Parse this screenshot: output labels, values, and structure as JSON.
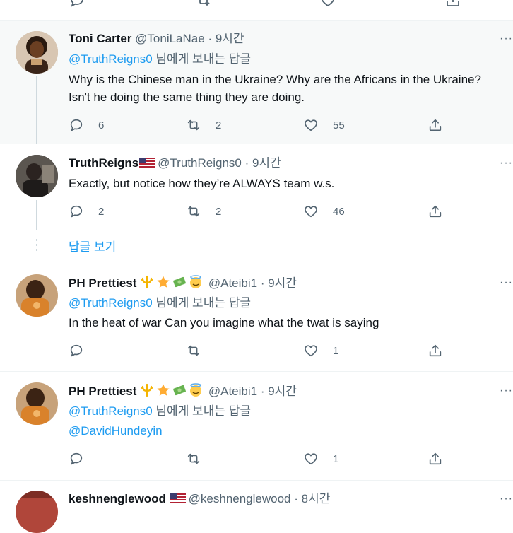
{
  "tweets": [
    {
      "name": "Toni Carter",
      "handle": "@ToniLaNae",
      "time": "9시간",
      "reply_to_handle": "@TruthReigns0",
      "reply_to_suffix": " 님에게 보내는 답글",
      "text": "Why is the Chinese man in the Ukraine? Why are the Africans in the Ukraine? Isn't he doing the same thing they are doing.",
      "replies": "6",
      "retweets": "2",
      "likes": "55"
    },
    {
      "name": "TruthReigns",
      "handle": "@TruthReigns0",
      "time": "9시간",
      "text": "Exactly, but notice how they’re ALWAYS team w.s.",
      "replies": "2",
      "retweets": "2",
      "likes": "46"
    },
    {
      "name": "PH Prettiest",
      "handle": "@Ateibi1",
      "time": "9시간",
      "reply_to_handle": "@TruthReigns0",
      "reply_to_suffix": " 님에게 보내는 답글",
      "text": "In the heat of war Can you imagine what the twat is saying",
      "likes": "1"
    },
    {
      "name": "PH Prettiest",
      "handle": "@Ateibi1",
      "time": "9시간",
      "reply_to_handle": "@TruthReigns0",
      "reply_to_suffix": " 님에게 보내는 답글",
      "mention_line": "@DavidHundeyin",
      "likes": "1"
    },
    {
      "name": "keshnenglewood",
      "handle": "@keshnenglewood",
      "time": "8시간"
    }
  ],
  "show_replies_label": "답글 보기",
  "sep": " · ",
  "more_glyph": "···",
  "icons": [
    "reply-icon",
    "retweet-icon",
    "like-icon",
    "share-icon",
    "more-icon",
    "us-flag-icon",
    "trident-emoji",
    "star-emoji",
    "money-emoji",
    "halo-emoji"
  ],
  "colors": {
    "accent": "#1d9bf0",
    "muted": "#536471",
    "highlight_bg": "#f7f9f9",
    "text": "#0f1419"
  }
}
